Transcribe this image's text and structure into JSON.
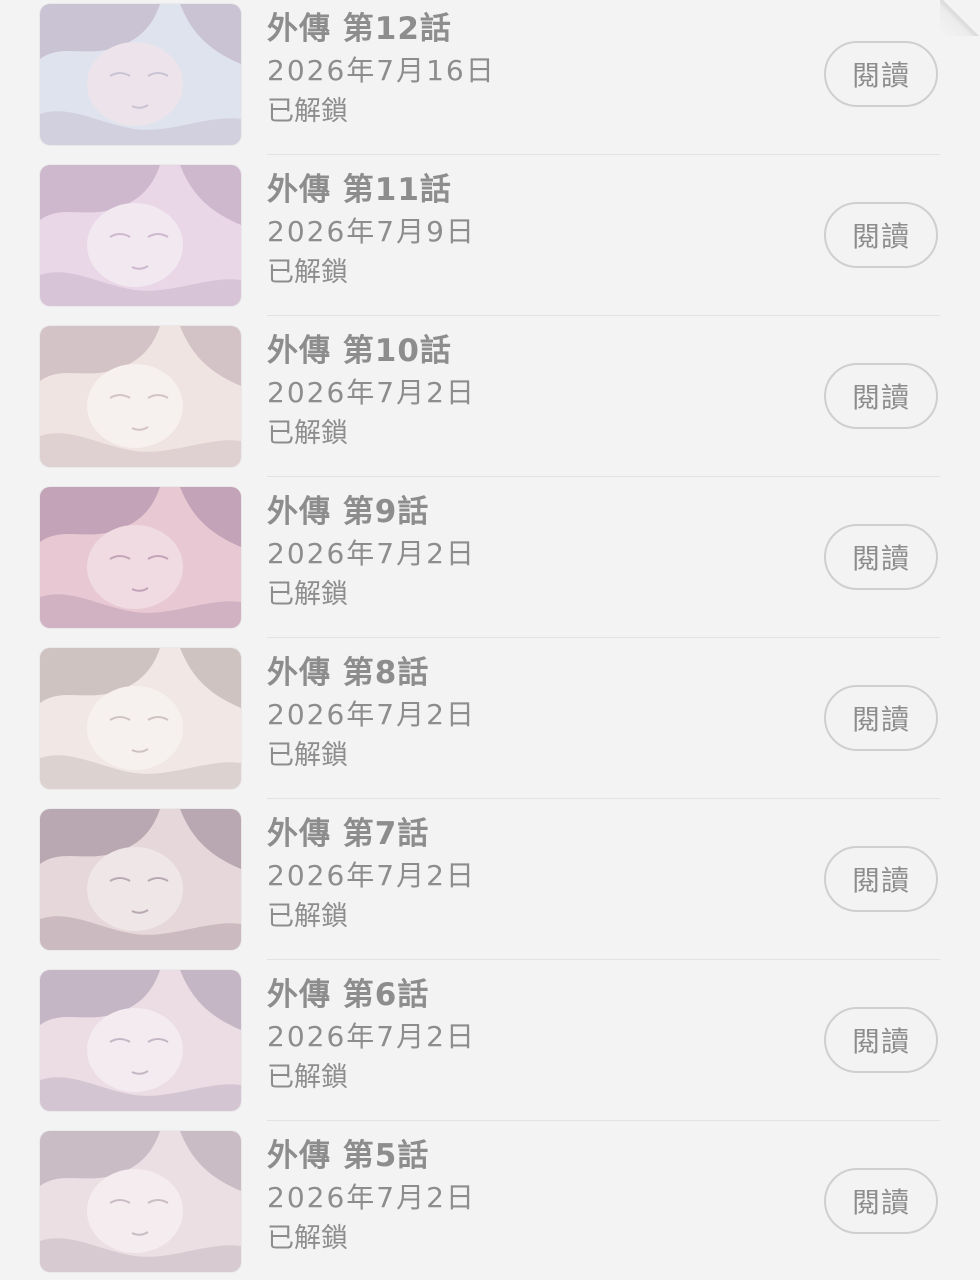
{
  "episodes": [
    {
      "title": "外傳 第12話",
      "date": "2026年7月16日",
      "status": "已解鎖",
      "button": "閱讀",
      "thumb_colors": [
        "#dfe3ee",
        "#c9c3d3",
        "#ece4ea"
      ]
    },
    {
      "title": "外傳 第11話",
      "date": "2026年7月9日",
      "status": "已解鎖",
      "button": "閱讀",
      "thumb_colors": [
        "#e9d6e7",
        "#cdb8cd",
        "#f1e8f0"
      ]
    },
    {
      "title": "外傳 第10話",
      "date": "2026年7月2日",
      "status": "已解鎖",
      "button": "閱讀",
      "thumb_colors": [
        "#efe4e1",
        "#d3c3c6",
        "#f6f0ee"
      ]
    },
    {
      "title": "外傳 第9話",
      "date": "2026年7月2日",
      "status": "已解鎖",
      "button": "閱讀",
      "thumb_colors": [
        "#e8c9d3",
        "#c2a3b7",
        "#f0dbe2"
      ]
    },
    {
      "title": "外傳 第8話",
      "date": "2026年7月2日",
      "status": "已解鎖",
      "button": "閱讀",
      "thumb_colors": [
        "#f1e8e6",
        "#cfc3c2",
        "#f6f1ef"
      ]
    },
    {
      "title": "外傳 第7話",
      "date": "2026年7月2日",
      "status": "已解鎖",
      "button": "閱讀",
      "thumb_colors": [
        "#e6d7da",
        "#b9a8b1",
        "#efe6e8"
      ]
    },
    {
      "title": "外傳 第6話",
      "date": "2026年7月2日",
      "status": "已解鎖",
      "button": "閱讀",
      "thumb_colors": [
        "#ecdde5",
        "#c5b6c6",
        "#f3ebf0"
      ]
    },
    {
      "title": "外傳 第5話",
      "date": "2026年7月2日",
      "status": "已解鎖",
      "button": "閱讀",
      "thumb_colors": [
        "#ecdfe3",
        "#c9bcc4",
        "#f4ecee"
      ]
    }
  ]
}
